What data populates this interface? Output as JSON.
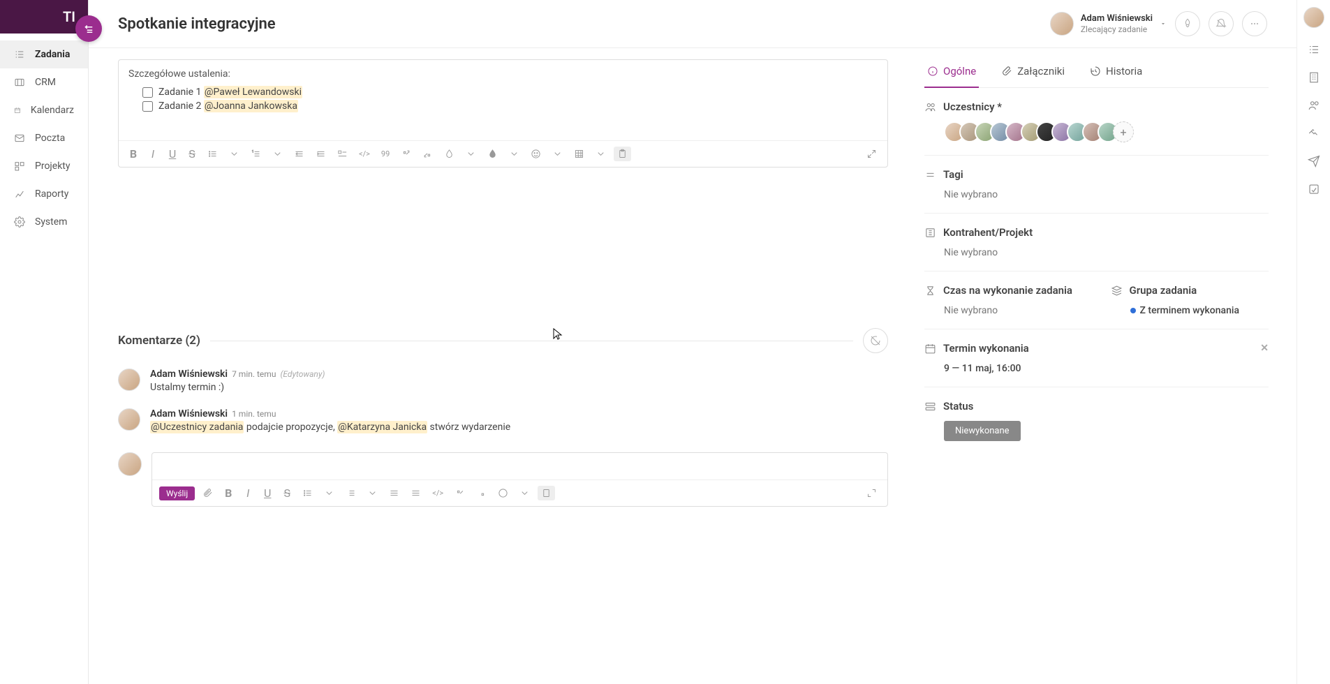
{
  "logo": "TI",
  "nav": {
    "tasks": "Zadania",
    "crm": "CRM",
    "calendar": "Kalendarz",
    "mail": "Poczta",
    "projects": "Projekty",
    "reports": "Raporty",
    "system": "System"
  },
  "header": {
    "title": "Spotkanie integracyjne",
    "user_name": "Adam Wiśniewski",
    "user_role": "Zlecający zadanie"
  },
  "editor": {
    "label": "Szczegółowe ustalenia:",
    "tasks": [
      {
        "prefix": "Zadanie 1 ",
        "mention": "@Paweł Lewandowski"
      },
      {
        "prefix": "Zadanie 2 ",
        "mention": "@Joanna Jankowska"
      }
    ]
  },
  "comments": {
    "title": "Komentarze (2)",
    "items": [
      {
        "author": "Adam Wiśniewski",
        "time": "7 min. temu",
        "edited": "(Edytowany)",
        "text": "Ustalmy termin :)"
      },
      {
        "author": "Adam Wiśniewski",
        "time": "1 min. temu",
        "edited": "",
        "mention1": "@Uczestnicy zadania",
        "mid": " podajcie propozycje, ",
        "mention2": "@Katarzyna Janicka",
        "tail": " stwórz wydarzenie"
      }
    ],
    "send": "Wyślij"
  },
  "panel": {
    "tab_general": "Ogólne",
    "tab_attachments": "Załączniki",
    "tab_history": "Historia",
    "participants_label": "Uczestnicy *",
    "tags_label": "Tagi",
    "not_selected": "Nie wybrano",
    "contractor_label": "Kontrahent/Projekt",
    "time_label": "Czas na wykonanie zadania",
    "group_label": "Grupa zadania",
    "group_value": "Z terminem wykonania",
    "deadline_label": "Termin wykonania",
    "deadline_value": "9 — 11 maj, 16:00",
    "status_label": "Status",
    "status_value": "Niewykonane",
    "participant_count": 11
  }
}
